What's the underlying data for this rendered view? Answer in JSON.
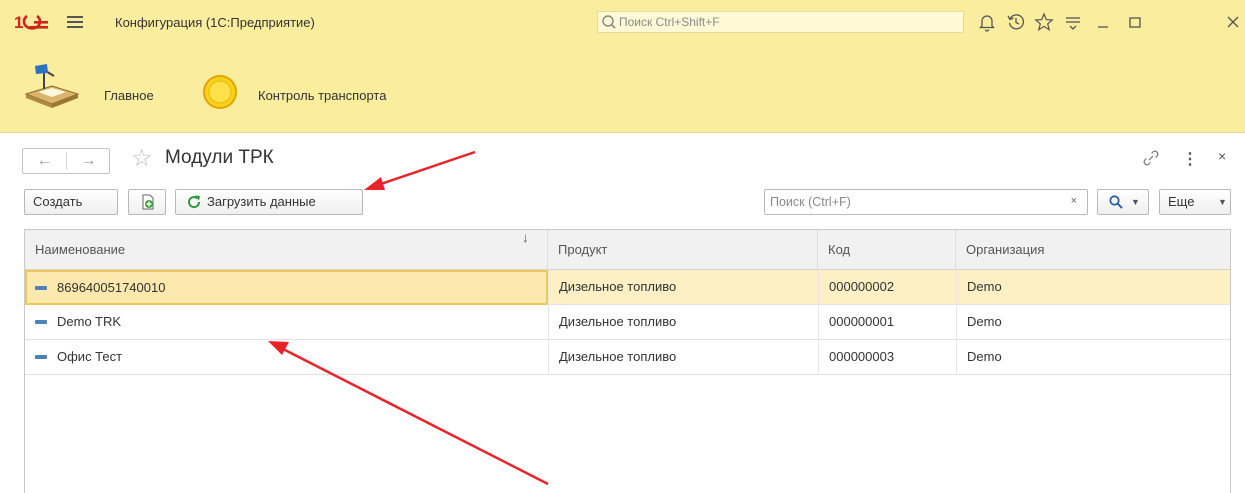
{
  "titlebar": {
    "app_title": "Конфигурация  (1С:Предприятие)",
    "search_placeholder": "Поиск Ctrl+Shift+F",
    "icons": [
      "logo-1c-icon",
      "menu-icon",
      "bell-icon",
      "history-icon",
      "star-icon",
      "settings-icon",
      "minimize-icon",
      "maximize-icon",
      "close-icon"
    ]
  },
  "sections": [
    {
      "label": "Главное",
      "icon": "desk-lamp-icon"
    },
    {
      "label": "Контроль транспорта",
      "icon": "yellow-circle-icon"
    }
  ],
  "form": {
    "title": "Модули ТРК",
    "toolbar": {
      "create_label": "Создать",
      "load_label": "Загрузить данные",
      "search_placeholder": "Поиск (Ctrl+F)",
      "search_clear": "×",
      "more_label": "Еще"
    }
  },
  "table": {
    "columns": [
      "Наименование",
      "Продукт",
      "Код",
      "Организация"
    ],
    "sort_indicator": "↓",
    "rows": [
      {
        "name": "869640051740010",
        "product": "Дизельное топливо",
        "code": "000000002",
        "org": "Demo",
        "selected": true
      },
      {
        "name": "Demo TRK",
        "product": "Дизельное топливо",
        "code": "000000001",
        "org": "Demo",
        "selected": false
      },
      {
        "name": "Офис Тест",
        "product": "Дизельное топливо",
        "code": "000000003",
        "org": "Demo",
        "selected": false
      }
    ]
  },
  "colors": {
    "accent_yellow": "#fbed9e",
    "selection": "#fcf0c4",
    "annotation_red": "#e8242a"
  }
}
